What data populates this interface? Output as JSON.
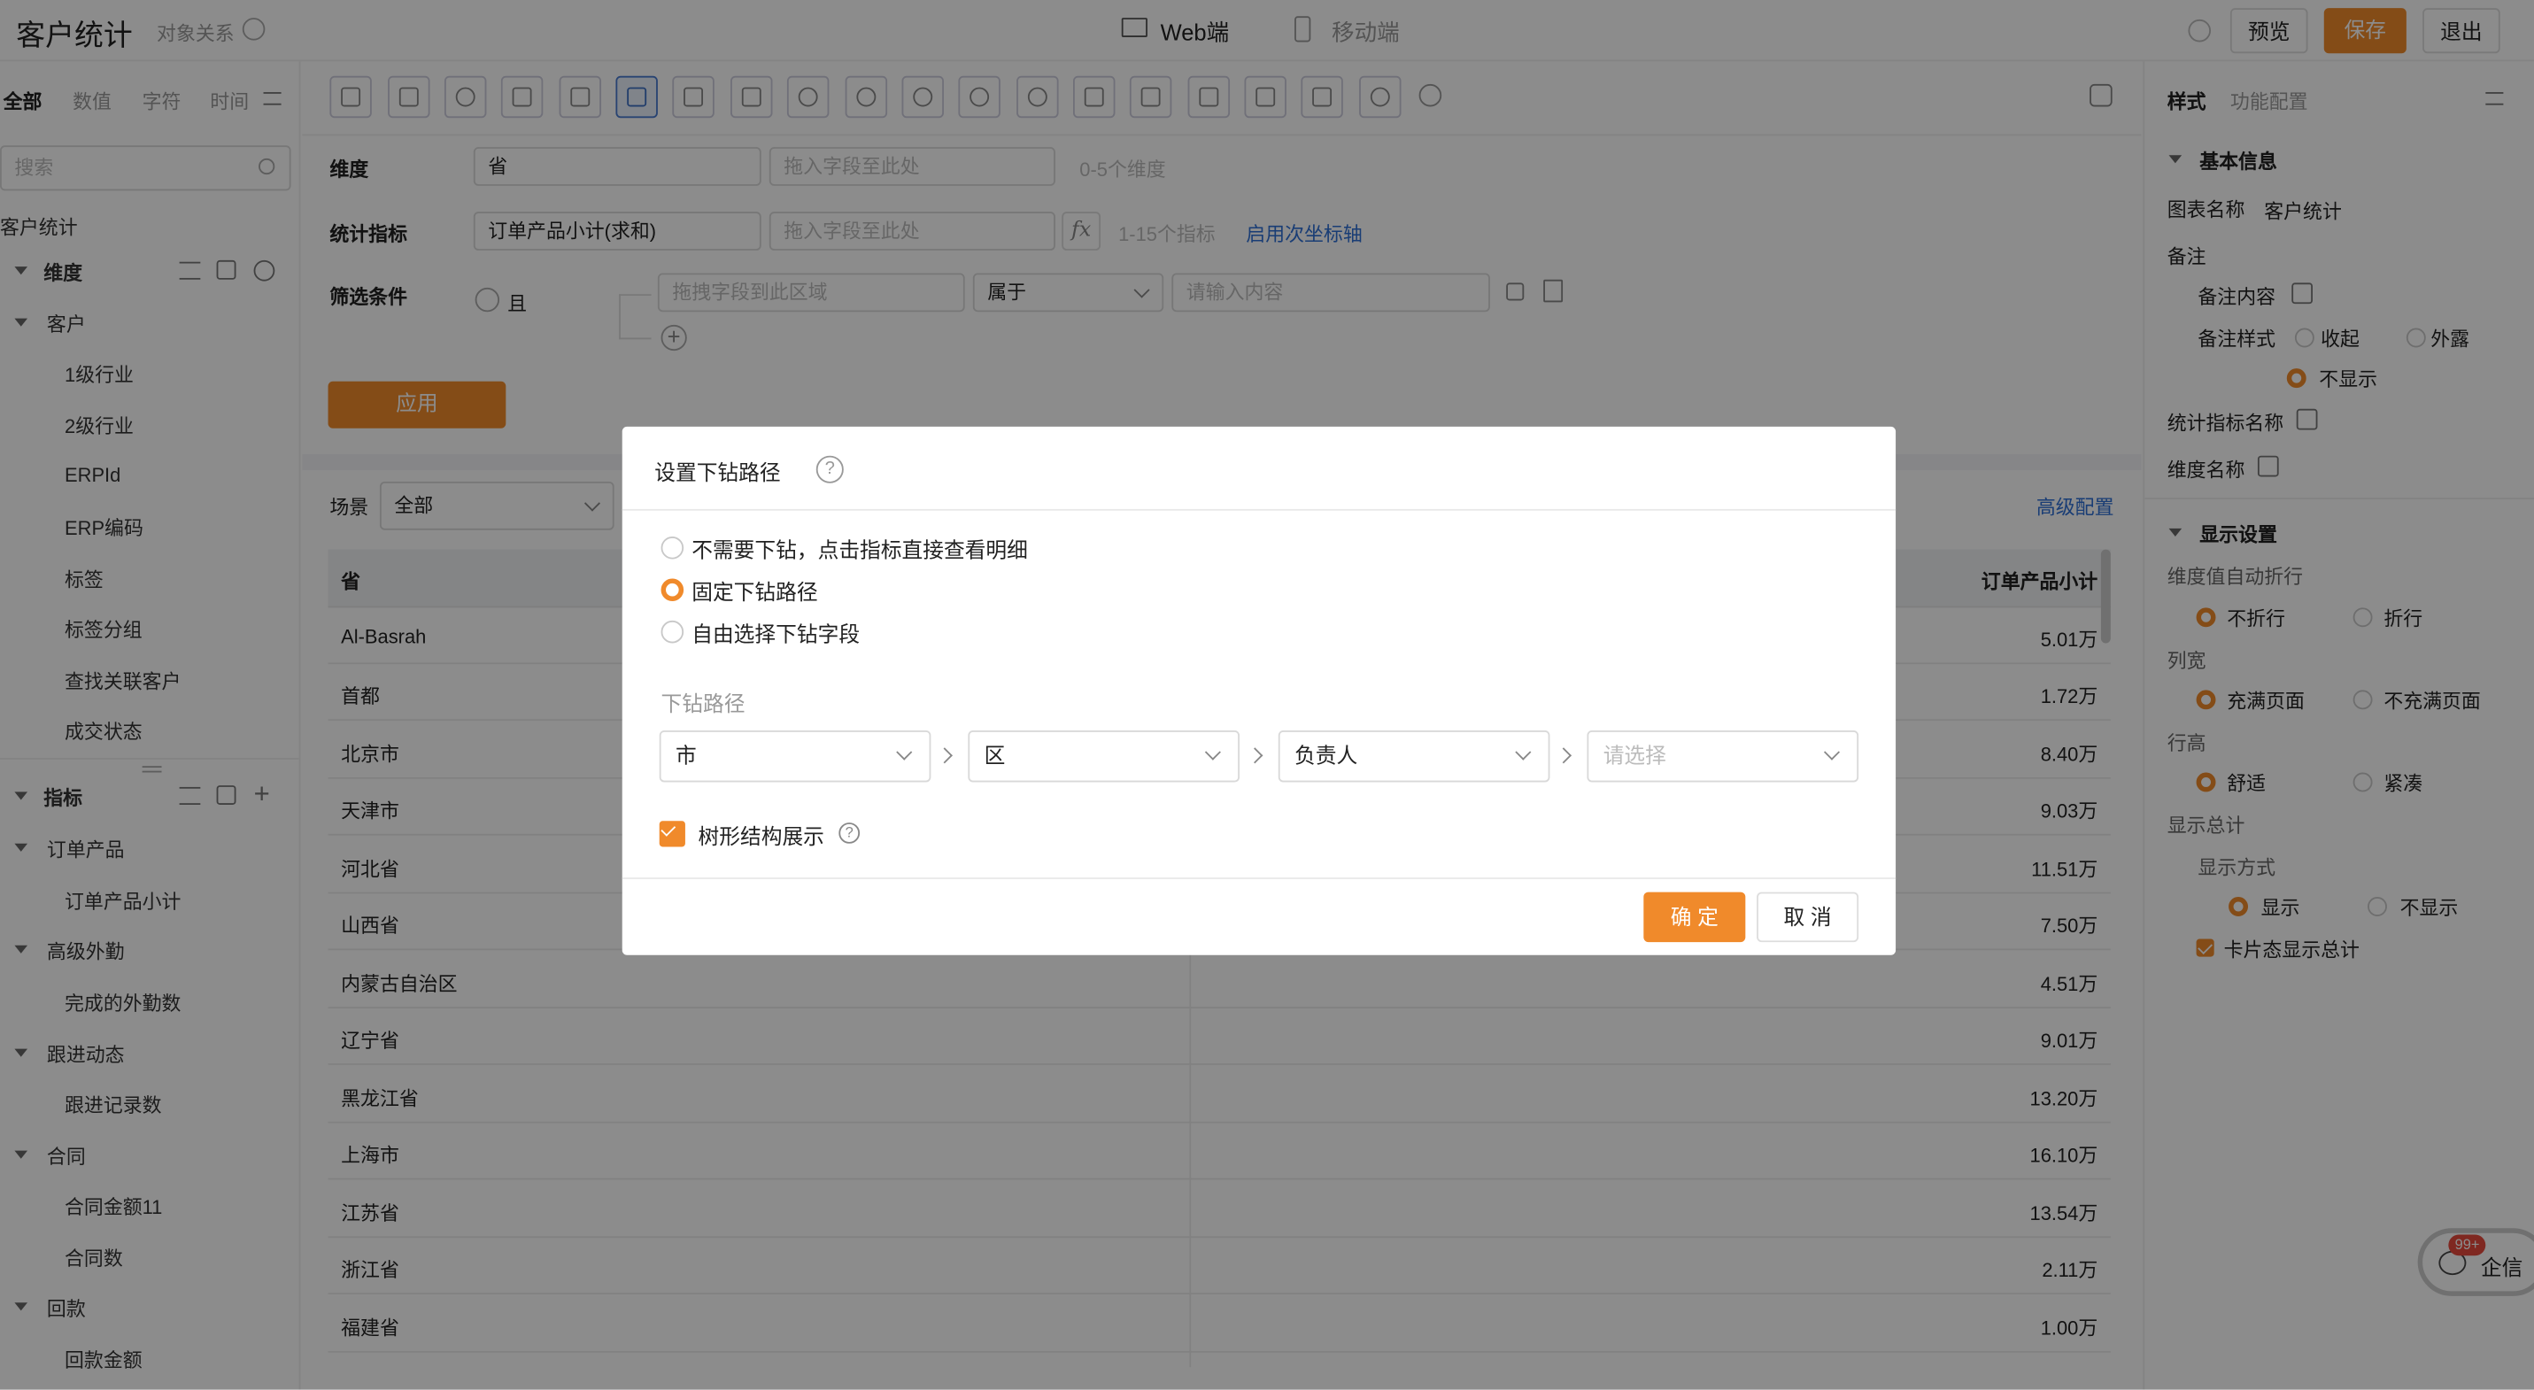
{
  "header": {
    "title": "客户统计",
    "subtitle": "对象关系",
    "tabs": [
      "Web端",
      "移动端"
    ],
    "preview": "预览",
    "save": "保存",
    "exit": "退出"
  },
  "left": {
    "filters": [
      "全部",
      "数值",
      "字符",
      "时间"
    ],
    "search_placeholder": "搜索",
    "root": "客户统计",
    "dim_title": "维度",
    "dim_group": "客户",
    "dim_items": [
      "1级行业",
      "2级行业",
      "ERPId",
      "ERP编码",
      "标签",
      "标签分组",
      "查找关联客户",
      "成交状态"
    ],
    "metric_title": "指标",
    "metric_groups": [
      {
        "name": "订单产品",
        "items": [
          "订单产品小计"
        ]
      },
      {
        "name": "高级外勤",
        "items": [
          "完成的外勤数"
        ]
      },
      {
        "name": "跟进动态",
        "items": [
          "跟进记录数"
        ]
      },
      {
        "name": "合同",
        "items": [
          "合同金额11",
          "合同数"
        ]
      },
      {
        "name": "回款",
        "items": [
          "回款金额"
        ]
      }
    ]
  },
  "config": {
    "dim_label": "维度",
    "dim_value": "省",
    "dim_drop": "拖入字段至此处",
    "dim_hint": "0-5个维度",
    "metric_label": "统计指标",
    "metric_value": "订单产品小计(求和)",
    "metric_drop": "拖入字段至此处",
    "metric_hint": "1-15个指标",
    "metric_link": "启用次坐标轴",
    "filter_label": "筛选条件",
    "filter_and": "且",
    "filter_field": "拖拽字段到此区域",
    "filter_op": "属于",
    "filter_value": "请输入内容",
    "apply": "应用"
  },
  "table": {
    "scene_label": "场景",
    "scene_value": "全部",
    "advanced": "高级配置",
    "col1": "省",
    "col2": "订单产品小计",
    "rows": [
      [
        "Al-Basrah",
        "5.01万"
      ],
      [
        "首都",
        "1.72万"
      ],
      [
        "北京市",
        "8.40万"
      ],
      [
        "天津市",
        "9.03万"
      ],
      [
        "河北省",
        "11.51万"
      ],
      [
        "山西省",
        "7.50万"
      ],
      [
        "内蒙古自治区",
        "4.51万"
      ],
      [
        "辽宁省",
        "9.01万"
      ],
      [
        "黑龙江省",
        "13.20万"
      ],
      [
        "上海市",
        "16.10万"
      ],
      [
        "江苏省",
        "13.54万"
      ],
      [
        "浙江省",
        "2.11万"
      ],
      [
        "福建省",
        "1.00万"
      ]
    ]
  },
  "right": {
    "tabs": [
      "样式",
      "功能配置"
    ],
    "basic_title": "基本信息",
    "chart_name_label": "图表名称",
    "chart_name": "客户统计",
    "note_label": "备注",
    "note_content": "备注内容",
    "note_style": "备注样式",
    "note_opts": [
      "收起",
      "外露",
      "不显示"
    ],
    "metric_name": "统计指标名称",
    "dim_name": "维度名称",
    "display_title": "显示设置",
    "wrap_label": "维度值自动折行",
    "wrap_opts": [
      "不折行",
      "折行"
    ],
    "width_label": "列宽",
    "width_opts": [
      "充满页面",
      "不充满页面"
    ],
    "height_label": "行高",
    "height_opts": [
      "舒适",
      "紧凑"
    ],
    "total_label": "显示总计",
    "total_mode": "显示方式",
    "total_opts": [
      "显示",
      "不显示"
    ],
    "card_total": "卡片态显示总计"
  },
  "chat": {
    "badge": "99+",
    "label": "企信"
  },
  "modal": {
    "title": "设置下钻路径",
    "options": [
      "不需要下钻，点击指标直接查看明细",
      "固定下钻路径",
      "自由选择下钻字段"
    ],
    "selected": 1,
    "path_label": "下钻路径",
    "path": [
      "市",
      "区",
      "负责人"
    ],
    "path_placeholder": "请选择",
    "tree_label": "树形结构展示",
    "ok": "确 定",
    "cancel": "取 消"
  },
  "colors": {
    "accent": "#f08a2b",
    "link": "#2f6fd6"
  }
}
